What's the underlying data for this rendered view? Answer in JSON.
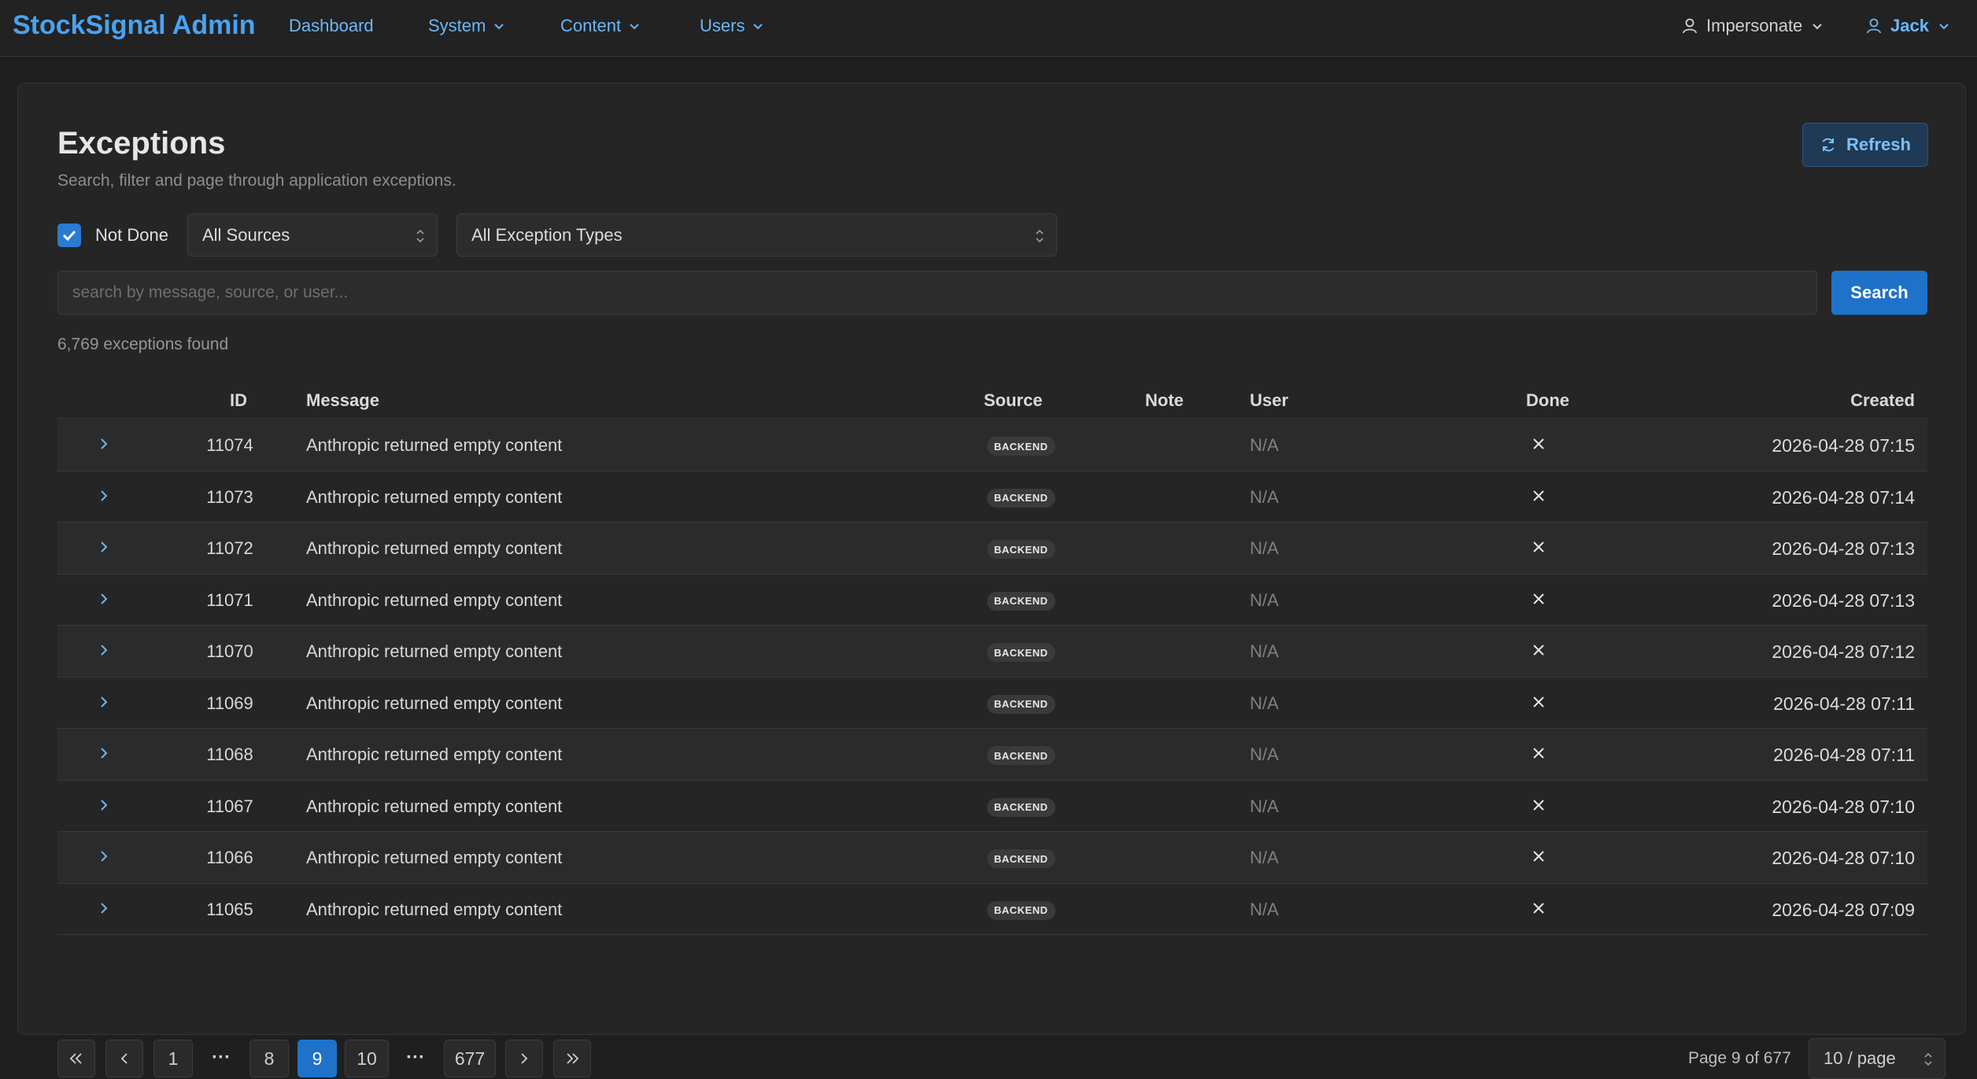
{
  "nav": {
    "brand": "StockSignal Admin",
    "items": [
      {
        "label": "Dashboard"
      },
      {
        "label": "System"
      },
      {
        "label": "Content"
      },
      {
        "label": "Users"
      }
    ],
    "impersonate_label": "Impersonate",
    "user_label": "Jack"
  },
  "page": {
    "title": "Exceptions",
    "subtitle": "Search, filter and page through application exceptions.",
    "refresh_label": "Refresh"
  },
  "filters": {
    "not_done_label": "Not Done",
    "not_done_checked": true,
    "source_value": "All Sources",
    "type_value": "All Exception Types",
    "search_placeholder": "search by message, source, or user...",
    "search_value": "",
    "search_button_label": "Search"
  },
  "results": {
    "count_text": "6,769 exceptions found"
  },
  "table": {
    "headers": {
      "id": "ID",
      "message": "Message",
      "source": "Source",
      "note": "Note",
      "user": "User",
      "done": "Done",
      "created": "Created"
    },
    "rows": [
      {
        "id": "11074",
        "message": "Anthropic returned empty content",
        "source": "BACKEND",
        "note": "",
        "user": "N/A",
        "done": false,
        "created": "2026-04-28 07:15"
      },
      {
        "id": "11073",
        "message": "Anthropic returned empty content",
        "source": "BACKEND",
        "note": "",
        "user": "N/A",
        "done": false,
        "created": "2026-04-28 07:14"
      },
      {
        "id": "11072",
        "message": "Anthropic returned empty content",
        "source": "BACKEND",
        "note": "",
        "user": "N/A",
        "done": false,
        "created": "2026-04-28 07:13"
      },
      {
        "id": "11071",
        "message": "Anthropic returned empty content",
        "source": "BACKEND",
        "note": "",
        "user": "N/A",
        "done": false,
        "created": "2026-04-28 07:13"
      },
      {
        "id": "11070",
        "message": "Anthropic returned empty content",
        "source": "BACKEND",
        "note": "",
        "user": "N/A",
        "done": false,
        "created": "2026-04-28 07:12"
      },
      {
        "id": "11069",
        "message": "Anthropic returned empty content",
        "source": "BACKEND",
        "note": "",
        "user": "N/A",
        "done": false,
        "created": "2026-04-28 07:11"
      },
      {
        "id": "11068",
        "message": "Anthropic returned empty content",
        "source": "BACKEND",
        "note": "",
        "user": "N/A",
        "done": false,
        "created": "2026-04-28 07:11"
      },
      {
        "id": "11067",
        "message": "Anthropic returned empty content",
        "source": "BACKEND",
        "note": "",
        "user": "N/A",
        "done": false,
        "created": "2026-04-28 07:10"
      },
      {
        "id": "11066",
        "message": "Anthropic returned empty content",
        "source": "BACKEND",
        "note": "",
        "user": "N/A",
        "done": false,
        "created": "2026-04-28 07:10"
      },
      {
        "id": "11065",
        "message": "Anthropic returned empty content",
        "source": "BACKEND",
        "note": "",
        "user": "N/A",
        "done": false,
        "created": "2026-04-28 07:09"
      }
    ]
  },
  "pagination": {
    "first_page": "1",
    "prev_page": "8",
    "current_page": "9",
    "next_page": "10",
    "last_page": "677",
    "ellipsis": "···",
    "status_text": "Page 9 of 677",
    "page_size_value": "10 / page"
  },
  "colors": {
    "accent": "#1f72c9",
    "brand": "#4aa2f0",
    "background": "#1f1f1f"
  }
}
